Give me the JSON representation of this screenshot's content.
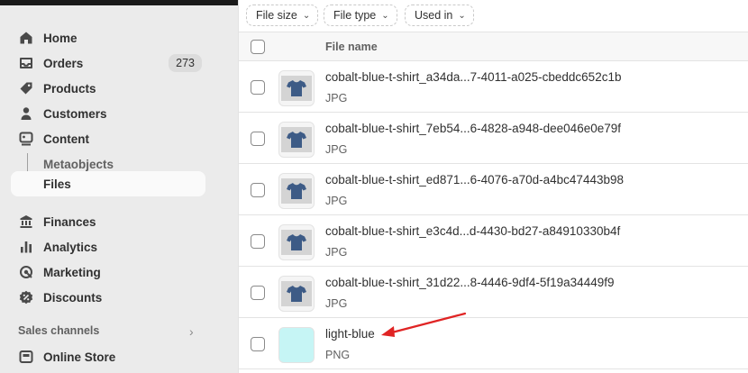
{
  "sidebar": {
    "items": [
      {
        "label": "Home",
        "icon": "home-icon"
      },
      {
        "label": "Orders",
        "icon": "inbox-icon",
        "badge": "273"
      },
      {
        "label": "Products",
        "icon": "tag-icon"
      },
      {
        "label": "Customers",
        "icon": "person-icon"
      },
      {
        "label": "Content",
        "icon": "content-icon"
      },
      {
        "label": "Metaobjects"
      },
      {
        "label": "Files"
      },
      {
        "label": "Finances",
        "icon": "bank-icon"
      },
      {
        "label": "Analytics",
        "icon": "bar-chart-icon"
      },
      {
        "label": "Marketing",
        "icon": "target-icon"
      },
      {
        "label": "Discounts",
        "icon": "discount-icon"
      }
    ],
    "sales_channels_label": "Sales channels",
    "online_store_label": "Online Store"
  },
  "filters": [
    "File size",
    "File type",
    "Used in"
  ],
  "table": {
    "header": "File name",
    "rows": [
      {
        "name": "cobalt-blue-t-shirt_a34da...7-4011-a025-cbeddc652c1b",
        "type": "JPG"
      },
      {
        "name": "cobalt-blue-t-shirt_7eb54...6-4828-a948-dee046e0e79f",
        "type": "JPG"
      },
      {
        "name": "cobalt-blue-t-shirt_ed871...6-4076-a70d-a4bc47443b98",
        "type": "JPG"
      },
      {
        "name": "cobalt-blue-t-shirt_e3c4d...d-4430-bd27-a84910330b4f",
        "type": "JPG"
      },
      {
        "name": "cobalt-blue-t-shirt_31d22...8-4446-9df4-5f19a34449f9",
        "type": "JPG"
      },
      {
        "name": "light-blue",
        "type": "PNG"
      }
    ]
  },
  "colors": {
    "swatch": "#c6f5f5",
    "shirt": "#3d5b86",
    "arrow": "#e02424"
  }
}
